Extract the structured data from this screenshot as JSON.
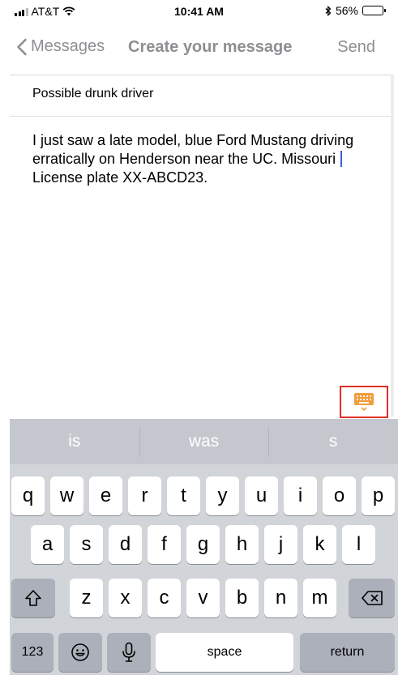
{
  "status_bar": {
    "carrier": "AT&T",
    "time": "10:41 AM",
    "battery": "56%",
    "battery_level": 0.56,
    "icons": [
      "signal-icon",
      "wifi-icon",
      "bluetooth-icon",
      "battery-icon"
    ]
  },
  "nav": {
    "back_label": "Messages",
    "title": "Create your message",
    "send_label": "Send"
  },
  "compose": {
    "subject": "Possible drunk driver",
    "body_before_cursor": "I just saw a late model, blue Ford Mustang driving erratically on Henderson near the UC. Missouri ",
    "body_after_cursor": "License plate XX-ABCD23."
  },
  "keyboard": {
    "suggestions": [
      "is",
      "was",
      "s"
    ],
    "row1": [
      "q",
      "w",
      "e",
      "r",
      "t",
      "y",
      "u",
      "i",
      "o",
      "p"
    ],
    "row2": [
      "a",
      "s",
      "d",
      "f",
      "g",
      "h",
      "j",
      "k",
      "l"
    ],
    "row3": [
      "z",
      "x",
      "c",
      "v",
      "b",
      "n",
      "m"
    ],
    "numbers_label": "123",
    "space_label": "space",
    "return_label": "return",
    "icons": [
      "shift-icon",
      "backspace-icon",
      "emoji-icon",
      "microphone-icon",
      "keyboard-dismiss-icon"
    ]
  },
  "colors": {
    "nav_text": "#8e8e93",
    "cursor": "#3b5fd9",
    "highlight_box": "#e03025",
    "keyboard_icon": "#f39c3c"
  }
}
